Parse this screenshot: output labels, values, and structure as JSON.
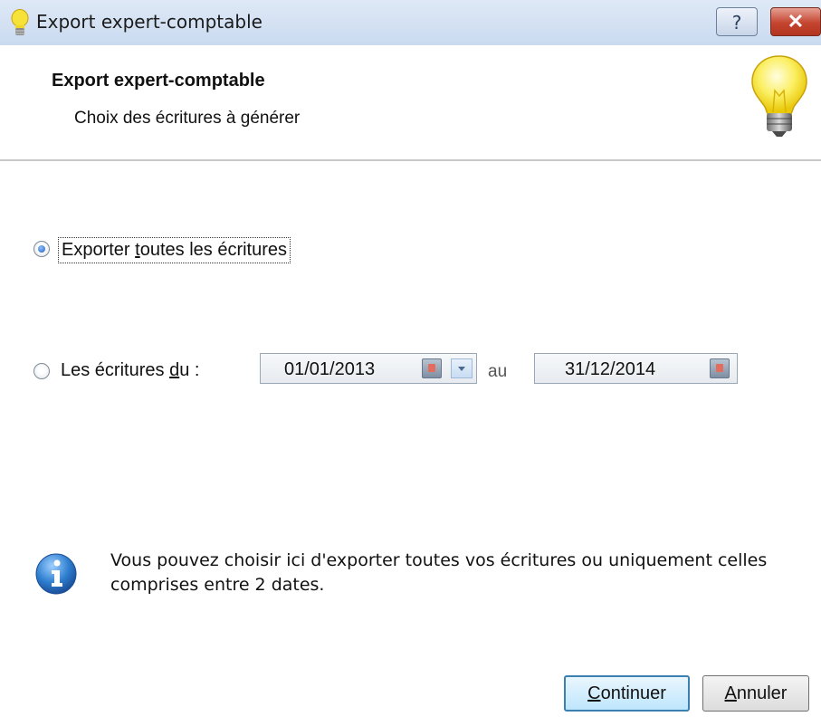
{
  "window": {
    "title": "Export expert-comptable",
    "help_label": "?",
    "close_label": "✕"
  },
  "header": {
    "title": "Export expert-comptable",
    "subtitle": "Choix des écritures à générer"
  },
  "options": {
    "export_all": {
      "label_pre": "Exporter ",
      "label_key": "t",
      "label_post": "outes les écritures",
      "checked": true
    },
    "date_range": {
      "label_pre": "Les écritures ",
      "label_key": "d",
      "label_post": "u :",
      "checked": false,
      "from": "01/01/2013",
      "separator": "au",
      "to": "31/12/2014"
    }
  },
  "info": {
    "text": "Vous pouvez choisir ici d'exporter toutes vos écritures ou uniquement celles comprises entre 2 dates."
  },
  "buttons": {
    "continue_key": "C",
    "continue_rest": "ontinuer",
    "cancel_key": "A",
    "cancel_rest": "nnuler"
  },
  "icons": {
    "title": "lightbulb-icon",
    "header": "lightbulb-icon",
    "info": "info-icon",
    "calendar": "calendar-icon",
    "dropdown": "chevron-down-icon"
  },
  "colors": {
    "title_bar": "#c9daf0",
    "close_button": "#c4442f",
    "default_button_border": "#3c7fb1",
    "info_blue": "#2f7fd0"
  }
}
